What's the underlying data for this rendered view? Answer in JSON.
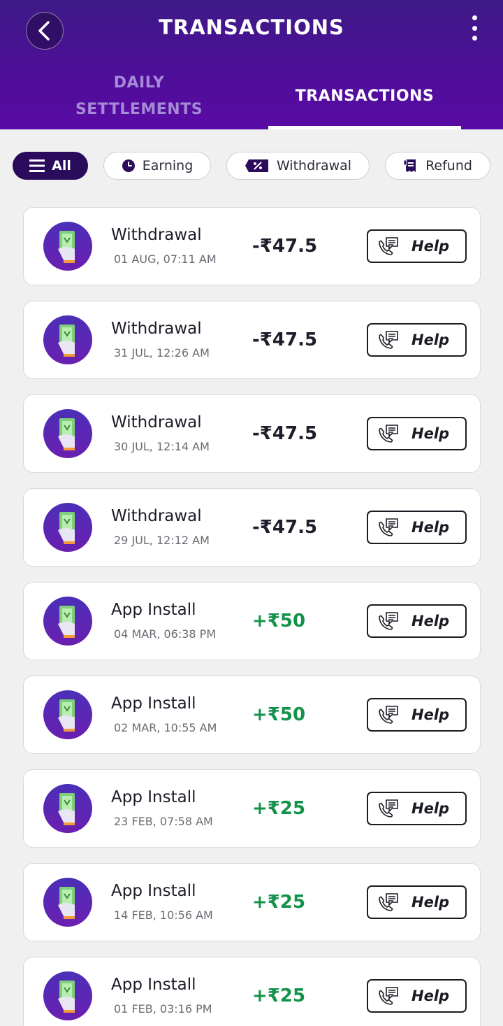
{
  "header": {
    "title": "TRANSACTIONS",
    "back_icon": "chevron-left-icon",
    "more_icon": "more-vertical-icon"
  },
  "tabs": {
    "daily_line1": "DAILY",
    "daily_line2": "SETTLEMENTS",
    "transactions": "TRANSACTIONS",
    "active": "transactions"
  },
  "filters": {
    "all": "All",
    "earning": "Earning",
    "withdrawal": "Withdrawal",
    "refund": "Refund",
    "active": "all"
  },
  "help_label": "Help",
  "colors": {
    "header_top": "#3e1a86",
    "header_bottom": "#5a0aa4",
    "active_chip": "#2a0b5c",
    "positive": "#15924a",
    "negative": "#1d1d2b"
  },
  "transactions": [
    {
      "title": "Withdrawal",
      "date": "01 AUG, 07:11 AM",
      "amount": "-₹47.5",
      "sign": "neg"
    },
    {
      "title": "Withdrawal",
      "date": "31 JUL, 12:26 AM",
      "amount": "-₹47.5",
      "sign": "neg"
    },
    {
      "title": "Withdrawal",
      "date": "30 JUL, 12:14 AM",
      "amount": "-₹47.5",
      "sign": "neg"
    },
    {
      "title": "Withdrawal",
      "date": "29 JUL, 12:12 AM",
      "amount": "-₹47.5",
      "sign": "neg"
    },
    {
      "title": "App Install",
      "date": "04 MAR, 06:38 PM",
      "amount": "+₹50",
      "sign": "pos"
    },
    {
      "title": "App Install",
      "date": "02 MAR, 10:55 AM",
      "amount": "+₹50",
      "sign": "pos"
    },
    {
      "title": "App Install",
      "date": "23 FEB, 07:58 AM",
      "amount": "+₹25",
      "sign": "pos"
    },
    {
      "title": "App Install",
      "date": "14 FEB, 10:56 AM",
      "amount": "+₹25",
      "sign": "pos"
    },
    {
      "title": "App Install",
      "date": "01 FEB, 03:16 PM",
      "amount": "+₹25",
      "sign": "pos"
    }
  ]
}
